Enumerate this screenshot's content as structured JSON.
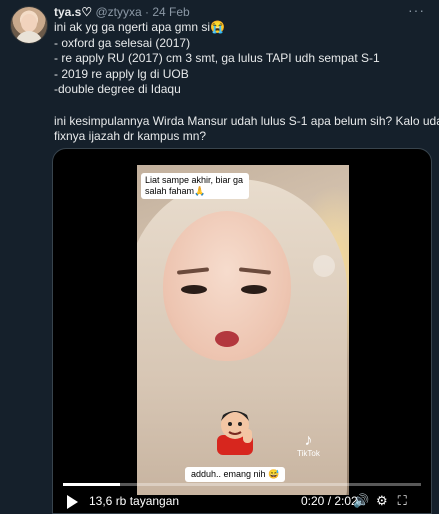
{
  "tweet": {
    "name": "tya.s♡",
    "handle": "@ztyyxa",
    "separator": "·",
    "date": "24 Feb",
    "more_icon": "···",
    "lines": [
      "ini ak yg ga ngerti apa gmn si😭",
      "- oxford ga selesai (2017)",
      "- re apply RU (2017) cm 3 smt, ga lulus  TAPI udh sempat S-1",
      "- 2019 re apply lg di UOB",
      "-double degree di Idaqu"
    ],
    "paragraph2": [
      "ini kesimpulannya Wirda Mansur udah lulus S-1 apa belum sih? Kalo udah,",
      "fixnya ijazah dr kampus mn?"
    ]
  },
  "video": {
    "caption": "Liat sampe akhir, biar ga salah faham🙏",
    "subtitle": "adduh.. emang nih 😅",
    "tiktok_label": "TikTok",
    "tiktok_logo": "♪",
    "views": "13,6 rb tayangan",
    "time": "0:20 / 2:02",
    "progress": 0.16,
    "icons": {
      "volume": "🔊",
      "settings": "⚙",
      "fullscreen": "⛶"
    }
  }
}
